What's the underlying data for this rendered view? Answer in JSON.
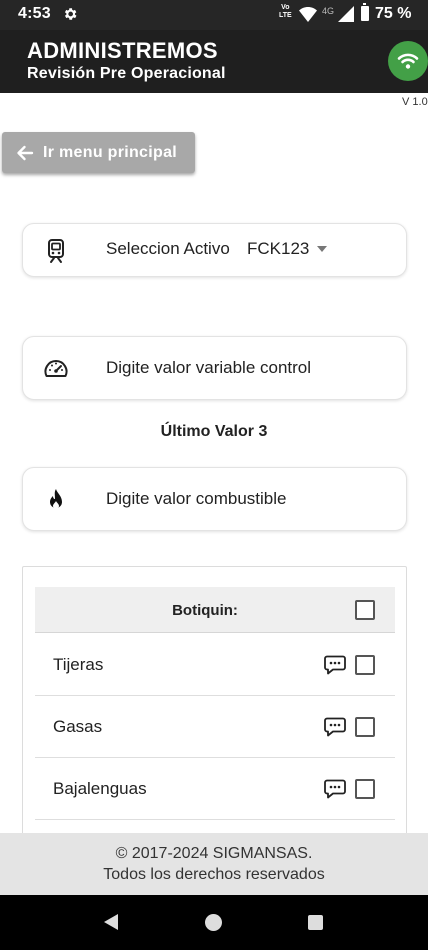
{
  "status_bar": {
    "time": "4:53",
    "volte_top": "Vo",
    "volte_bottom": "LTE",
    "network": "4G",
    "battery": "75 %",
    "icons": [
      "gear-icon",
      "wifi-signal-icon",
      "cell-signal-icon",
      "battery-icon"
    ]
  },
  "header": {
    "title": "ADMINISTREMOS",
    "subtitle": "Revisión Pre Operacional",
    "status_icon": "wifi-icon",
    "status_color": "#43a047"
  },
  "version": "V 1.0",
  "back_button": {
    "label": "Ir menu principal",
    "icon": "arrow-left-icon"
  },
  "asset_field": {
    "label": "Seleccion Activo",
    "value": "FCK123",
    "icon": "train-icon"
  },
  "control_field": {
    "label": "Digite valor variable control",
    "icon": "speedometer-icon"
  },
  "last_value": "Último Valor 3",
  "fuel_field": {
    "label": "Digite valor combustible",
    "icon": "fire-icon"
  },
  "checklist": {
    "title": "Botiquin:",
    "items": [
      {
        "label": "Tijeras",
        "checked": false
      },
      {
        "label": "Gasas",
        "checked": false
      },
      {
        "label": "Bajalenguas",
        "checked": false
      }
    ]
  },
  "footer": {
    "line1": "© 2017-2024 SIGMANSAS.",
    "line2": "Todos los derechos reservados"
  },
  "nav": {
    "icons": [
      "nav-back-icon",
      "nav-home-icon",
      "nav-recents-icon"
    ]
  }
}
